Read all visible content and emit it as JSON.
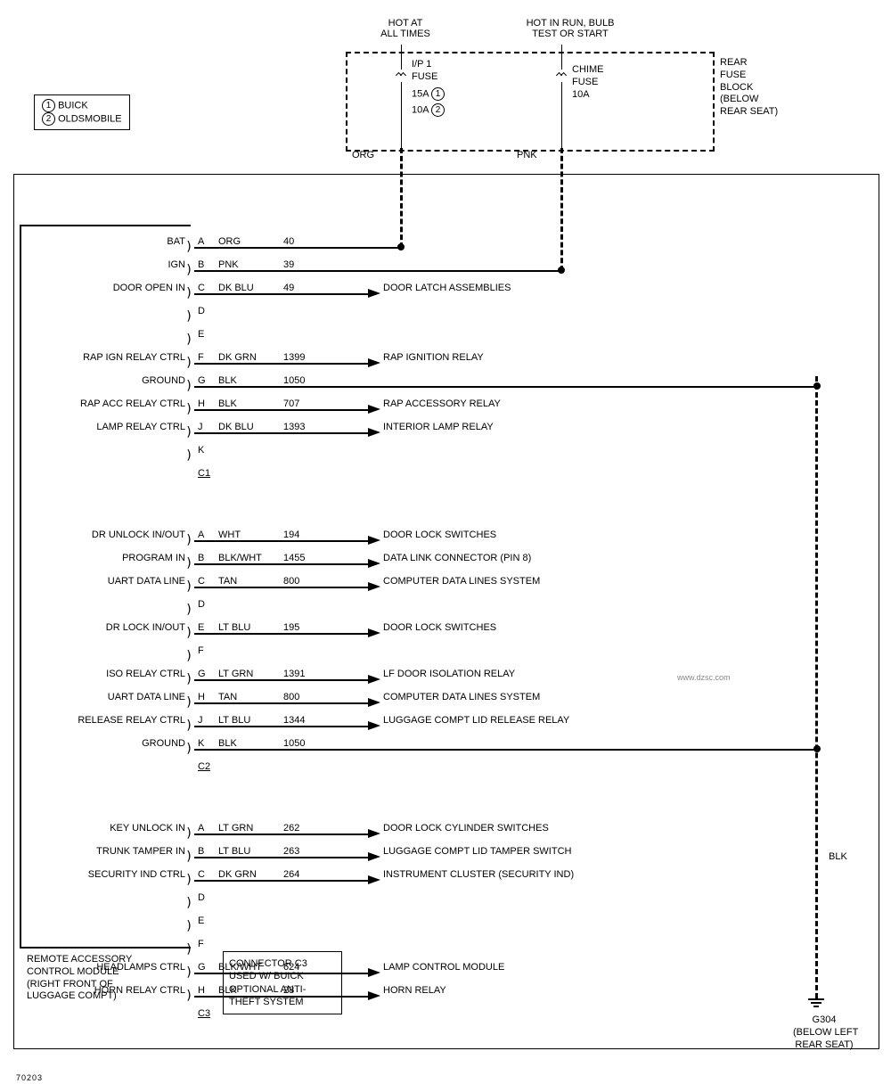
{
  "legend": {
    "l1": "BUICK",
    "l2": "OLDSMOBILE"
  },
  "fuse_box": {
    "header1": "HOT AT\nALL TIMES",
    "header2": "HOT IN RUN, BULB\nTEST OR START",
    "fuse1": {
      "name": "I/P 1",
      "type": "FUSE",
      "amp1": "15A",
      "amp2": "10A"
    },
    "fuse2": {
      "name": "CHIME",
      "type": "FUSE",
      "amp": "10A"
    },
    "side": "REAR\nFUSE\nBLOCK\n(BELOW\nREAR SEAT)",
    "wire1": "ORG",
    "wire2": "PNK"
  },
  "module": {
    "name": "REMOTE ACCESSORY\nCONTROL MODULE\n(RIGHT FRONT OF\nLUGGAGE COMPT)"
  },
  "notes": {
    "c3": "CONNECTOR C3\nUSED W/ BUICK\nOPTIONAL ANTI-\nTHEFT SYSTEM"
  },
  "ground": {
    "name": "G304",
    "loc": "(BELOW LEFT\nREAR SEAT)",
    "wire": "BLK"
  },
  "connectors": {
    "c1": {
      "label": "C1",
      "pins": [
        {
          "pin": "A",
          "left": "BAT",
          "color": "ORG",
          "ckt": "40",
          "dest": "",
          "to_fuse": true,
          "arrow": false
        },
        {
          "pin": "B",
          "left": "IGN",
          "color": "PNK",
          "ckt": "39",
          "dest": "",
          "to_fuse2": true,
          "arrow": false
        },
        {
          "pin": "C",
          "left": "DOOR OPEN IN",
          "color": "DK BLU",
          "ckt": "49",
          "dest": "DOOR LATCH ASSEMBLIES",
          "arrow": true
        },
        {
          "pin": "D",
          "left": "",
          "color": "",
          "ckt": "",
          "dest": "",
          "arrow": false,
          "stub": true
        },
        {
          "pin": "E",
          "left": "",
          "color": "",
          "ckt": "",
          "dest": "",
          "arrow": false,
          "stub": true
        },
        {
          "pin": "F",
          "left": "RAP IGN RELAY CTRL",
          "color": "DK GRN",
          "ckt": "1399",
          "dest": "RAP IGNITION RELAY",
          "arrow": true
        },
        {
          "pin": "G",
          "left": "GROUND",
          "color": "BLK",
          "ckt": "1050",
          "dest": "",
          "arrow": false,
          "to_ground": true
        },
        {
          "pin": "H",
          "left": "RAP ACC RELAY CTRL",
          "color": "BLK",
          "ckt": "707",
          "dest": "RAP ACCESSORY RELAY",
          "arrow": true
        },
        {
          "pin": "J",
          "left": "LAMP RELAY CTRL",
          "color": "DK BLU",
          "ckt": "1393",
          "dest": "INTERIOR LAMP RELAY",
          "arrow": true
        },
        {
          "pin": "K",
          "left": "",
          "color": "",
          "ckt": "",
          "dest": "",
          "arrow": false,
          "stub": true
        }
      ]
    },
    "c2": {
      "label": "C2",
      "pins": [
        {
          "pin": "A",
          "left": "DR UNLOCK IN/OUT",
          "color": "WHT",
          "ckt": "194",
          "dest": "DOOR LOCK SWITCHES",
          "arrow": true
        },
        {
          "pin": "B",
          "left": "PROGRAM IN",
          "color": "BLK/WHT",
          "ckt": "1455",
          "dest": "DATA LINK CONNECTOR (PIN 8)",
          "arrow": true
        },
        {
          "pin": "C",
          "left": "UART DATA LINE",
          "color": "TAN",
          "ckt": "800",
          "dest": "COMPUTER DATA LINES SYSTEM",
          "arrow": true
        },
        {
          "pin": "D",
          "left": "",
          "color": "",
          "ckt": "",
          "dest": "",
          "arrow": false,
          "stub": true
        },
        {
          "pin": "E",
          "left": "DR LOCK IN/OUT",
          "color": "LT BLU",
          "ckt": "195",
          "dest": "DOOR LOCK SWITCHES",
          "arrow": true
        },
        {
          "pin": "F",
          "left": "",
          "color": "",
          "ckt": "",
          "dest": "",
          "arrow": false,
          "stub": true
        },
        {
          "pin": "G",
          "left": "ISO RELAY CTRL",
          "color": "LT GRN",
          "ckt": "1391",
          "dest": "LF DOOR ISOLATION RELAY",
          "arrow": true
        },
        {
          "pin": "H",
          "left": "UART DATA LINE",
          "color": "TAN",
          "ckt": "800",
          "dest": "COMPUTER DATA LINES SYSTEM",
          "arrow": true
        },
        {
          "pin": "J",
          "left": "RELEASE RELAY CTRL",
          "color": "LT BLU",
          "ckt": "1344",
          "dest": "LUGGAGE COMPT LID RELEASE RELAY",
          "arrow": true
        },
        {
          "pin": "K",
          "left": "GROUND",
          "color": "BLK",
          "ckt": "1050",
          "dest": "",
          "arrow": false,
          "to_ground": true
        }
      ]
    },
    "c3": {
      "label": "C3",
      "pins": [
        {
          "pin": "A",
          "left": "KEY UNLOCK IN",
          "color": "LT GRN",
          "ckt": "262",
          "dest": "DOOR LOCK CYLINDER SWITCHES",
          "arrow": true
        },
        {
          "pin": "B",
          "left": "TRUNK TAMPER IN",
          "color": "LT BLU",
          "ckt": "263",
          "dest": "LUGGAGE COMPT LID TAMPER SWITCH",
          "arrow": true
        },
        {
          "pin": "C",
          "left": "SECURITY IND CTRL",
          "color": "DK GRN",
          "ckt": "264",
          "dest": "INSTRUMENT CLUSTER (SECURITY IND)",
          "arrow": true
        },
        {
          "pin": "D",
          "left": "",
          "color": "",
          "ckt": "",
          "dest": "",
          "arrow": false,
          "stub": true
        },
        {
          "pin": "E",
          "left": "",
          "color": "",
          "ckt": "",
          "dest": "",
          "arrow": false,
          "stub": true
        },
        {
          "pin": "F",
          "left": "",
          "color": "",
          "ckt": "",
          "dest": "",
          "arrow": false,
          "stub": true
        },
        {
          "pin": "G",
          "left": "HEADLAMPS CTRL",
          "color": "BLK/WHT",
          "ckt": "624",
          "dest": "LAMP CONTROL MODULE",
          "arrow": true
        },
        {
          "pin": "H",
          "left": "HORN RELAY CTRL",
          "color": "BLK",
          "ckt": "28",
          "dest": "HORN RELAY",
          "arrow": true
        }
      ]
    }
  },
  "footer": "70203"
}
